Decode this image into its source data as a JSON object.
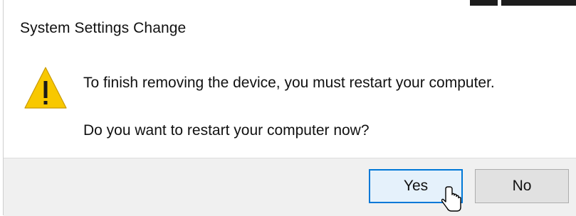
{
  "window": {
    "title": "System Settings Change"
  },
  "message": {
    "line1": "To finish removing the device, you must restart your computer.",
    "line2": "Do you want to restart your computer now?"
  },
  "buttons": {
    "yes_label": "Yes",
    "no_label": "No"
  },
  "icons": {
    "status": "warning-icon",
    "pointer": "mouse-pointer-icon"
  },
  "colors": {
    "accent": "#0078d7",
    "warning_fill": "#f8c800",
    "footer_bg": "#f0f0f0"
  }
}
